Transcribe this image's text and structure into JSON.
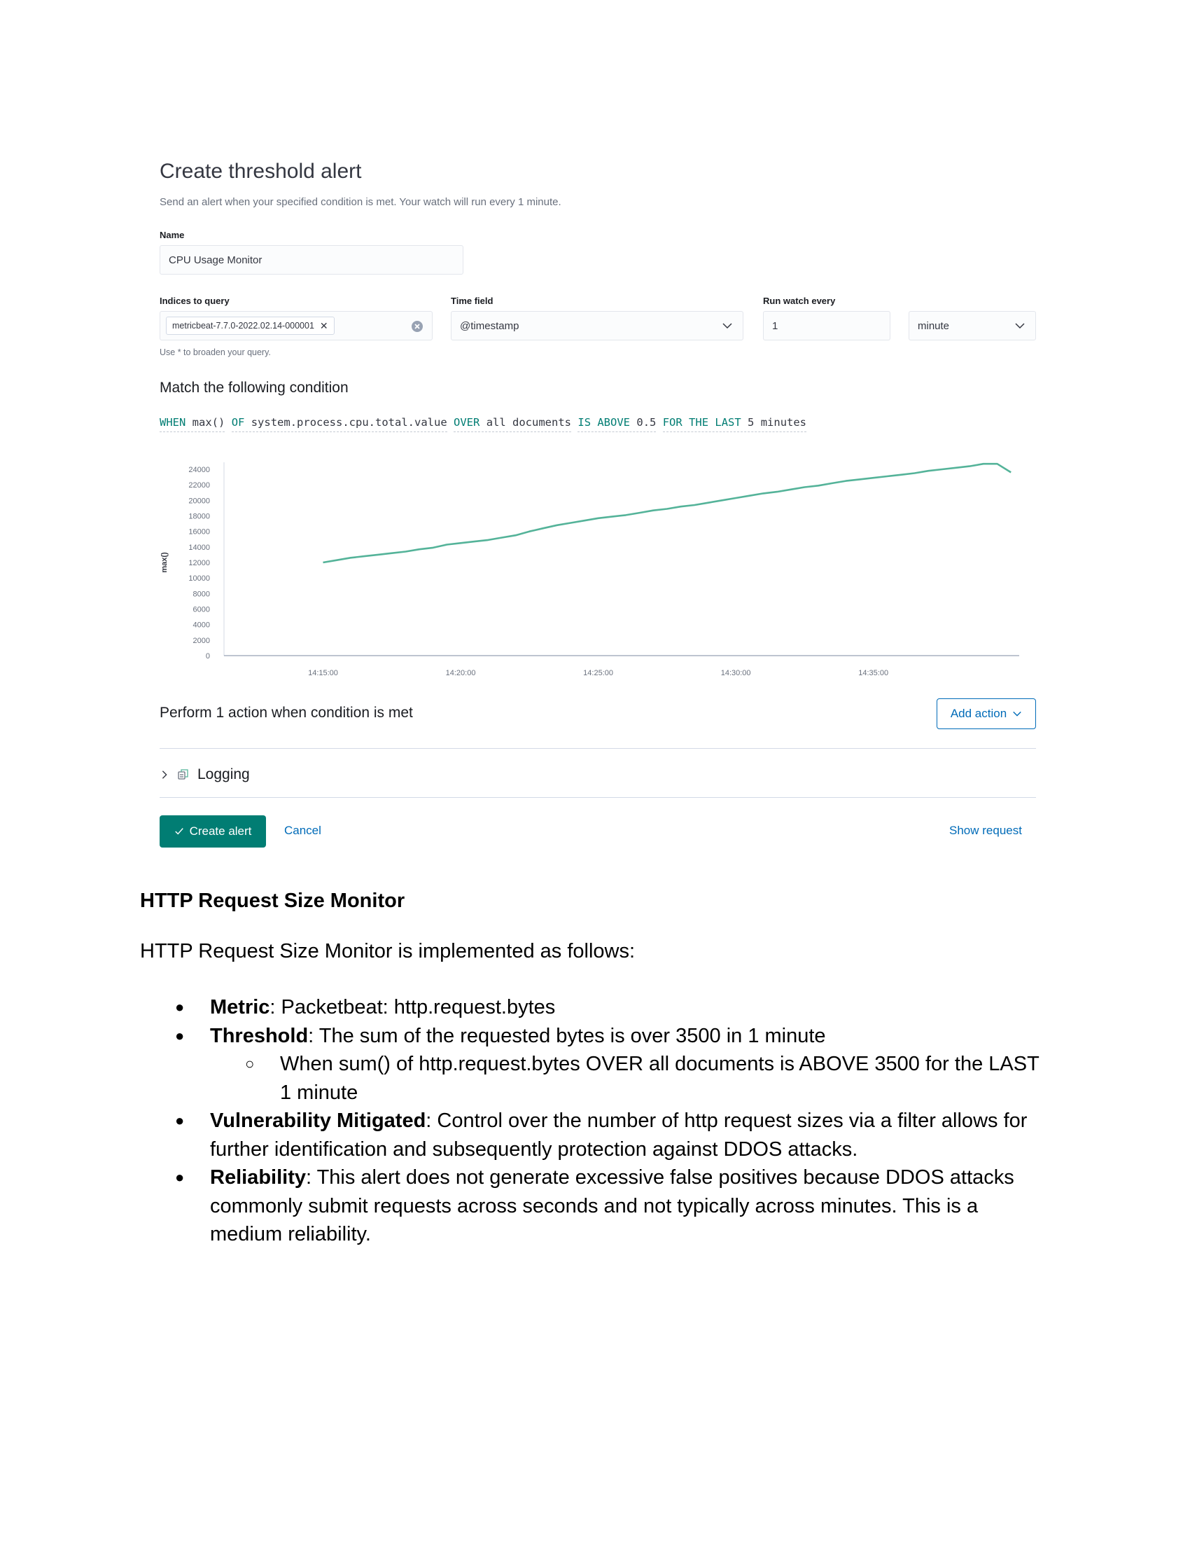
{
  "form": {
    "title": "Create threshold alert",
    "subtitle": "Send an alert when your specified condition is met. Your watch will run every 1 minute.",
    "name_label": "Name",
    "name_value": "CPU Usage Monitor",
    "indices_label": "Indices to query",
    "indices_pill": "metricbeat-7.7.0-2022.02.14-000001",
    "indices_hint": "Use * to broaden your query.",
    "time_field_label": "Time field",
    "time_field_value": "@timestamp",
    "run_every_label": "Run watch every",
    "run_every_value": "1",
    "run_every_unit": "minute",
    "condition_heading": "Match the following condition",
    "expression": {
      "when": "WHEN",
      "agg": "max()",
      "of": "OF",
      "field": "system.process.cpu.total.value",
      "over": "OVER",
      "over_value": "all documents",
      "is_above": "IS ABOVE",
      "threshold": "0.5",
      "for_the_last": "FOR THE LAST",
      "window": "5 minutes"
    },
    "actions_heading": "Perform 1 action when condition is met",
    "add_action_label": "Add action",
    "logging_label": "Logging",
    "create_label": "Create alert",
    "cancel_label": "Cancel",
    "show_request_label": "Show request",
    "colors": {
      "accent": "#017d73",
      "link": "#006bb8",
      "line": "#54b399"
    }
  },
  "chart_data": {
    "type": "line",
    "ylabel": "max()",
    "ylim": [
      0,
      24000
    ],
    "yticks": [
      "24000",
      "22000",
      "20000",
      "18000",
      "16000",
      "14000",
      "12000",
      "10000",
      "8000",
      "6000",
      "4000",
      "2000",
      "0"
    ],
    "xticks": [
      "14:15:00",
      "14:20:00",
      "14:25:00",
      "14:30:00",
      "14:35:00"
    ],
    "x_minutes": [
      0,
      0.5,
      1,
      1.5,
      2,
      2.5,
      3,
      3.5,
      4,
      4.5,
      5,
      5.5,
      6,
      6.5,
      7,
      7.5,
      8,
      8.5,
      9,
      9.5,
      10,
      10.5,
      11,
      11.5,
      12,
      12.5,
      13,
      13.5,
      14,
      14.5,
      15,
      15.5,
      16,
      16.5,
      17,
      17.5,
      18,
      18.5,
      19,
      19.5,
      20,
      20.5,
      21,
      21.5,
      22,
      22.5,
      23,
      23.5,
      24,
      24.5,
      25
    ],
    "values": [
      12000,
      12300,
      12600,
      12800,
      13000,
      13200,
      13400,
      13700,
      13900,
      14300,
      14500,
      14700,
      14900,
      15200,
      15500,
      16000,
      16400,
      16800,
      17100,
      17400,
      17700,
      17900,
      18100,
      18400,
      18700,
      18900,
      19200,
      19400,
      19700,
      20000,
      20300,
      20600,
      20900,
      21100,
      21400,
      21700,
      21900,
      22200,
      22500,
      22700,
      22900,
      23100,
      23300,
      23500,
      23800,
      24000,
      24200,
      24400,
      24700,
      24700,
      23600
    ]
  },
  "doc": {
    "heading": "HTTP Request Size Monitor",
    "intro": "HTTP Request Size Monitor is implemented as follows:",
    "items": [
      {
        "label": "Metric",
        "text": ": Packetbeat: http.request.bytes"
      },
      {
        "label": "Threshold",
        "text": ": The sum of the requested bytes is over 3500 in 1 minute"
      },
      {
        "label": "Vulnerability Mitigated",
        "text": ": Control over the number of http request sizes via a filter allows for further identification and subsequently protection against DDOS attacks."
      },
      {
        "label": "Reliability",
        "text": ": This alert does not generate excessive false positives because DDOS attacks commonly submit requests across seconds and not typically across minutes. This is a medium reliability."
      }
    ],
    "threshold_sub": "When sum() of http.request.bytes OVER all documents is ABOVE 3500 for the LAST 1 minute"
  }
}
